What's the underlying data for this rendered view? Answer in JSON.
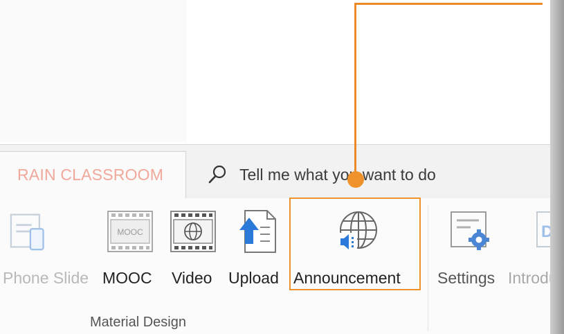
{
  "tab": {
    "label": "RAIN CLASSROOM"
  },
  "search": {
    "text": "Tell me what you want to do"
  },
  "ribbon": {
    "buttons": [
      {
        "label": "Phone Slide",
        "icon": "phone-slide-icon"
      },
      {
        "label": "MOOC",
        "icon": "mooc-icon",
        "badge": "MOOC"
      },
      {
        "label": "Video",
        "icon": "video-icon"
      },
      {
        "label": "Upload",
        "icon": "upload-icon"
      },
      {
        "label": "Announcement",
        "icon": "announcement-icon"
      },
      {
        "label": "Settings",
        "icon": "settings-icon"
      },
      {
        "label": "Introdu",
        "icon": "introduction-icon"
      }
    ],
    "group_label": "Material Design"
  },
  "colors": {
    "highlight": "#f0922b",
    "accent_blue": "#2b79d8",
    "tab_text": "#f2a79b"
  }
}
